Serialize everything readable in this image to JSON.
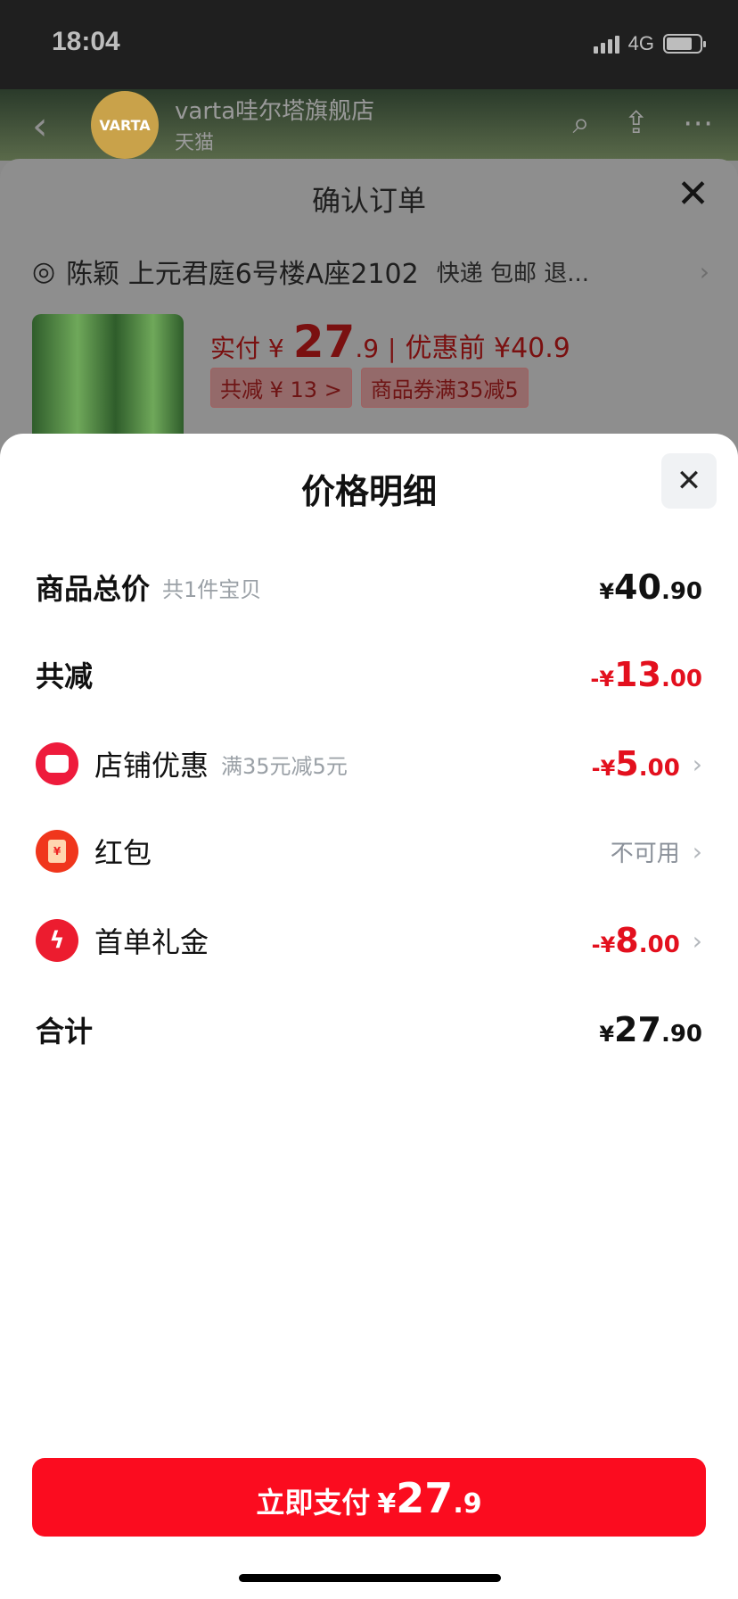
{
  "status_bar": {
    "time": "18:04",
    "network": "4G"
  },
  "shop_header": {
    "name": "varta哇尔塔旗舰店",
    "subtitle": "天猫",
    "logo_text": "VARTA",
    "icons": [
      "back-icon",
      "search-icon",
      "share-icon",
      "more-icon"
    ]
  },
  "order_sheet": {
    "title": "确认订单",
    "address": "陈颖 上元君庭6号楼A座2102",
    "delivery_tags": "快递 包邮 退...",
    "price_prefix": "实付 ¥",
    "price_int": "27",
    "price_dec": ".9",
    "separator": "|",
    "price_before": "优惠前 ¥40.9",
    "promo_tags": [
      "共减 ¥ 13 >",
      "商品券满35减5"
    ]
  },
  "price_detail": {
    "title": "价格明细",
    "rows": {
      "total": {
        "label": "商品总价",
        "sub": "共1件宝贝",
        "sym": "¥",
        "int": "40",
        "dec": ".90"
      },
      "reduce": {
        "label": "共减",
        "sym": "-¥",
        "int": "13",
        "dec": ".00"
      },
      "store": {
        "label": "店铺优惠",
        "sub": "满35元减5元",
        "sym": "-¥",
        "int": "5",
        "dec": ".00"
      },
      "redpacket": {
        "label": "红包",
        "status": "不可用"
      },
      "firstorder": {
        "label": "首单礼金",
        "sym": "-¥",
        "int": "8",
        "dec": ".00"
      },
      "sum": {
        "label": "合计",
        "sym": "¥",
        "int": "27",
        "dec": ".90"
      }
    }
  },
  "pay_button": {
    "label": "立即支付",
    "sym": "¥",
    "int": "27",
    "dec": ".9"
  },
  "colors": {
    "accent_red": "#fb0c1f",
    "discount_red": "#e3101e",
    "muted_gray": "#9aa0a6"
  }
}
